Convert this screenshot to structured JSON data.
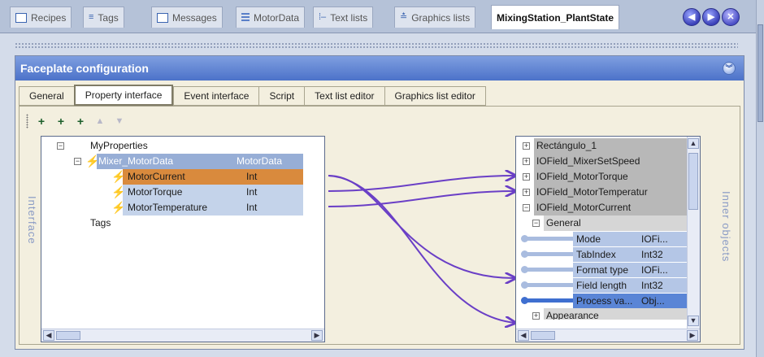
{
  "tabs": [
    {
      "label": "Recipes",
      "icon": "recipes-icon"
    },
    {
      "label": "Tags",
      "icon": "tags-icon"
    },
    {
      "label": "Messages",
      "icon": "messages-icon"
    },
    {
      "label": "MotorData",
      "icon": "motordata-icon"
    },
    {
      "label": "Text lists",
      "icon": "text-lists-icon"
    },
    {
      "label": "Graphics lists",
      "icon": "graphics-lists-icon"
    },
    {
      "label": "MixingStation_PlantState",
      "icon": ""
    }
  ],
  "nav": {
    "prev": "◀",
    "next": "▶",
    "close": "✕"
  },
  "panel": {
    "title": "Faceplate configuration",
    "subtabs": [
      "General",
      "Property interface",
      "Event interface",
      "Script",
      "Text list editor",
      "Graphics list editor"
    ],
    "active_subtab": "Property interface"
  },
  "interface_label": "Interface",
  "inner_label": "Inner objects",
  "tree": {
    "root": "MyProperties",
    "group": {
      "name": "Mixer_MotorData",
      "type": "MotorData"
    },
    "members": [
      {
        "name": "MotorCurrent",
        "type": "Int"
      },
      {
        "name": "MotorTorque",
        "type": "Int"
      },
      {
        "name": "MotorTemperature",
        "type": "Int"
      }
    ],
    "tags": "Tags"
  },
  "inner": {
    "objects": [
      "Rectángulo_1",
      "IOField_MixerSetSpeed",
      "IOField_MotorTorque",
      "IOField_MotorTemperatur",
      "IOField_MotorCurrent"
    ],
    "section": "General",
    "props": [
      {
        "name": "Mode",
        "type": "IOFi..."
      },
      {
        "name": "TabIndex",
        "type": "Int32"
      },
      {
        "name": "Format type",
        "type": "IOFi..."
      },
      {
        "name": "Field length",
        "type": "Int32"
      },
      {
        "name": "Process va...",
        "type": "Obj..."
      }
    ],
    "next_section": "Appearance"
  },
  "colors": {
    "header": "#4c72c9",
    "link": "#6a3fc6",
    "selected": "#d98a3d"
  }
}
